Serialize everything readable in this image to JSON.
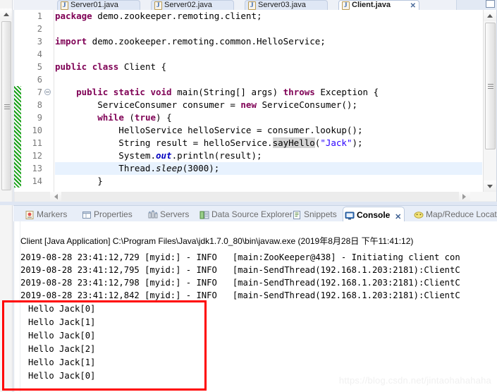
{
  "window": {
    "maximize_label": "▢"
  },
  "editor": {
    "tabs": [
      {
        "label": "Server01.java",
        "active": false,
        "icon": "java-file-icon"
      },
      {
        "label": "Server02.java",
        "active": false,
        "icon": "java-file-icon"
      },
      {
        "label": "Server03.java",
        "active": false,
        "icon": "java-file-icon"
      },
      {
        "label": "Client.java",
        "active": true,
        "icon": "java-file-icon",
        "close": "✕"
      }
    ],
    "line_numbers": [
      "1",
      "2",
      "3",
      "4",
      "5",
      "6",
      "7",
      "8",
      "9",
      "10",
      "11",
      "12",
      "13",
      "14"
    ],
    "highlighted_line": 13,
    "fold_line": 7,
    "code_lines": [
      "package demo.zookeeper.remoting.client;",
      "",
      "import demo.zookeeper.remoting.common.HelloService;",
      "",
      "public class Client {",
      "",
      "    public static void main(String[] args) throws Exception {",
      "        ServiceConsumer consumer = new ServiceConsumer();",
      "        while (true) {",
      "            HelloService helloService = consumer.lookup();",
      "            String result = helloService.sayHello(\"Jack\");",
      "            System.out.println(result);",
      "            Thread.sleep(3000);",
      "        }"
    ]
  },
  "view_tabs": [
    {
      "label": "Markers",
      "active": false,
      "icon": "markers-icon"
    },
    {
      "label": "Properties",
      "active": false,
      "icon": "properties-icon"
    },
    {
      "label": "Servers",
      "active": false,
      "icon": "servers-icon"
    },
    {
      "label": "Data Source Explorer",
      "active": false,
      "icon": "data-source-icon"
    },
    {
      "label": "Snippets",
      "active": false,
      "icon": "snippets-icon"
    },
    {
      "label": "Console",
      "active": true,
      "icon": "console-icon",
      "close": "✕"
    },
    {
      "label": "Map/Reduce Locations",
      "active": false,
      "icon": "mapreduce-icon"
    }
  ],
  "console": {
    "header": "Client [Java Application] C:\\Program Files\\Java\\jdk1.7.0_80\\bin\\javaw.exe (2019年8月28日 下午11:41:12)",
    "log_lines": [
      "2019-08-28 23:41:12,729 [myid:] - INFO   [main:ZooKeeper@438] - Initiating client con",
      "2019-08-28 23:41:12,795 [myid:] - INFO   [main-SendThread(192.168.1.203:2181):ClientC",
      "2019-08-28 23:41:12,798 [myid:] - INFO   [main-SendThread(192.168.1.203:2181):ClientC",
      "2019-08-28 23:41:12,842 [myid:] - INFO   [main-SendThread(192.168.1.203:2181):ClientC"
    ],
    "output_lines": [
      "Hello Jack[0]",
      "Hello Jack[1]",
      "Hello Jack[0]",
      "Hello Jack[2]",
      "Hello Jack[1]",
      "Hello Jack[0]"
    ],
    "highlight_color": "#ff0000"
  },
  "watermark": "https://blog.csdn.net/jintaohahahaha"
}
